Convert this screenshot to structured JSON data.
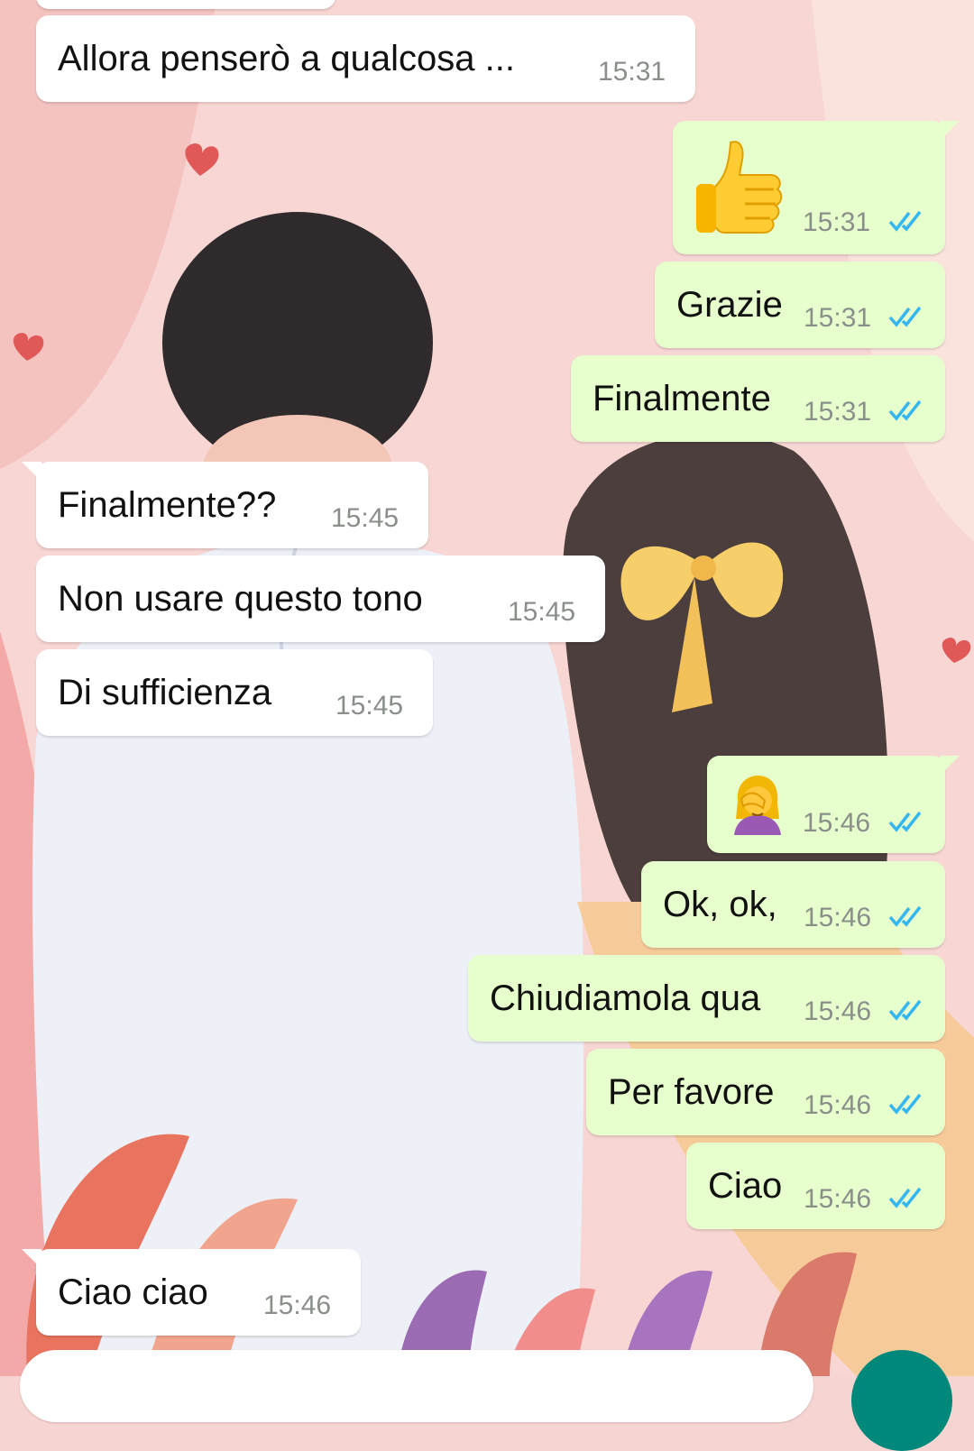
{
  "messages": [
    {
      "dir": "in",
      "text": "Allora penserò a qualcosa ...",
      "time": "15:31"
    },
    {
      "dir": "out",
      "emoji": "thumbs-up",
      "time": "15:31",
      "read": true
    },
    {
      "dir": "out",
      "text": "Grazie",
      "time": "15:31",
      "read": true
    },
    {
      "dir": "out",
      "text": "Finalmente",
      "time": "15:31",
      "read": true
    },
    {
      "dir": "in",
      "text": "Finalmente??",
      "time": "15:45"
    },
    {
      "dir": "in",
      "text": "Non usare questo tono",
      "time": "15:45"
    },
    {
      "dir": "in",
      "text": "Di sufficienza",
      "time": "15:45"
    },
    {
      "dir": "out",
      "emoji": "woman-facepalming",
      "time": "15:46",
      "read": true
    },
    {
      "dir": "out",
      "text": "Ok, ok,",
      "time": "15:46",
      "read": true
    },
    {
      "dir": "out",
      "text": "Chiudiamola qua",
      "time": "15:46",
      "read": true
    },
    {
      "dir": "out",
      "text": "Per favore",
      "time": "15:46",
      "read": true
    },
    {
      "dir": "out",
      "text": "Ciao",
      "time": "15:46",
      "read": true
    },
    {
      "dir": "in",
      "text": "Ciao ciao",
      "time": "15:46"
    }
  ],
  "colors": {
    "incoming_bubble": "#ffffff",
    "outgoing_bubble": "#e6ffcc",
    "read_ticks": "#34b7f1",
    "timestamp": "#8a8f8a",
    "send_button": "#00897b"
  }
}
